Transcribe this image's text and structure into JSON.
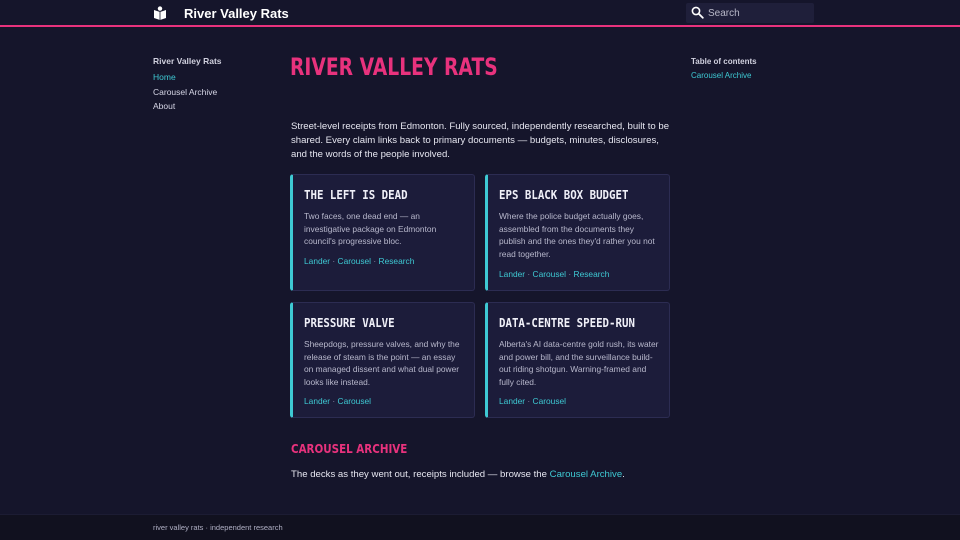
{
  "header": {
    "site_name": "River Valley Rats",
    "search_placeholder": "Search",
    "accent_color": "#e8327d"
  },
  "sidebar": {
    "title": "River Valley Rats",
    "items": [
      {
        "label": "Home",
        "active": true
      },
      {
        "label": "Carousel Archive",
        "active": false
      },
      {
        "label": "About",
        "active": false
      }
    ]
  },
  "toc": {
    "title": "Table of contents",
    "links": [
      "Carousel Archive"
    ]
  },
  "main": {
    "title": "RIVER VALLEY RATS",
    "intro": "Street-level receipts from Edmonton. Fully sourced, independently researched, built to be shared. Every claim links back to primary documents — budgets, minutes, disclosures, and the words of the people involved.",
    "cards": [
      {
        "title": "THE LEFT IS DEAD",
        "description": "Two faces, one dead end — an investigative package on Edmonton council's progressive bloc.",
        "links": [
          "Lander",
          "Carousel",
          "Research"
        ]
      },
      {
        "title": "EPS BLACK BOX BUDGET",
        "description": "Where the police budget actually goes, assembled from the documents they publish and the ones they'd rather you not read together.",
        "links": [
          "Lander",
          "Carousel",
          "Research"
        ]
      },
      {
        "title": "PRESSURE VALVE",
        "description": "Sheepdogs, pressure valves, and why the release of steam is the point — an essay on managed dissent and what dual power looks like instead.",
        "links": [
          "Lander",
          "Carousel"
        ]
      },
      {
        "title": "DATA-CENTRE SPEED-RUN",
        "description": "Alberta's AI data-centre gold rush, its water and power bill, and the surveillance build-out riding shotgun. Warning-framed and fully cited.",
        "links": [
          "Lander",
          "Carousel"
        ]
      }
    ],
    "section": {
      "title": "CAROUSEL ARCHIVE",
      "text_before": "The decks as they went out, receipts included — browse the ",
      "link_label": "Carousel Archive",
      "text_after": "."
    },
    "link_color": "#3ec9d3"
  },
  "footer": {
    "text": "river valley rats · independent research"
  }
}
